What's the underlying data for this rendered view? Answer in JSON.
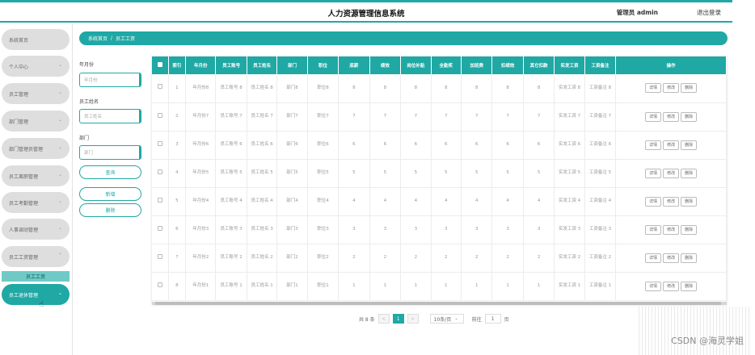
{
  "header": {
    "title": "人力资源管理信息系统",
    "admin": "管理员 admin",
    "logout": "退出登录"
  },
  "sidebar": {
    "items": [
      "系统首页",
      "个人中心",
      "员工管理",
      "部门管理",
      "部门管理员管理",
      "员工离职管理",
      "员工考勤管理",
      "人事调动管理",
      "员工工资管理",
      "员工退休管理"
    ],
    "sub_item": "员工工资"
  },
  "breadcrumb": {
    "home": "系统首页",
    "sep": "/",
    "current": "员工工资"
  },
  "filters": {
    "month_label": "年月份",
    "month_placeholder": "年月份",
    "name_label": "员工姓名",
    "name_placeholder": "员工姓名",
    "dept_label": "部门",
    "dept_placeholder": "部门",
    "search_btn": "查询",
    "add_btn": "新增",
    "delete_btn": "删除"
  },
  "table": {
    "headers": [
      "索引",
      "年月份",
      "员工账号",
      "员工姓名",
      "部门",
      "职位",
      "底薪",
      "绩效",
      "岗位补贴",
      "全勤奖",
      "加班费",
      "扣绩效",
      "其它扣款",
      "实发工资",
      "工资备注",
      "操作"
    ],
    "actions": {
      "detail": "详情",
      "edit": "修改",
      "delete": "删除"
    },
    "rows": [
      {
        "idx": "1",
        "month": "年月份8",
        "acct": "员工账号 8",
        "name": "员工姓名 8",
        "dept": "部门8",
        "pos": "职位8",
        "base": "8",
        "perf": "8",
        "allow": "8",
        "attend": "8",
        "ot": "8",
        "dperf": "8",
        "other": "8",
        "actual": "实发工资 8",
        "note": "工资备注 8"
      },
      {
        "idx": "2",
        "month": "年月份7",
        "acct": "员工账号 7",
        "name": "员工姓名 7",
        "dept": "部门7",
        "pos": "职位7",
        "base": "7",
        "perf": "7",
        "allow": "7",
        "attend": "7",
        "ot": "7",
        "dperf": "7",
        "other": "7",
        "actual": "实发工资 7",
        "note": "工资备注 7"
      },
      {
        "idx": "3",
        "month": "年月份6",
        "acct": "员工账号 6",
        "name": "员工姓名 6",
        "dept": "部门6",
        "pos": "职位6",
        "base": "6",
        "perf": "6",
        "allow": "6",
        "attend": "6",
        "ot": "6",
        "dperf": "6",
        "other": "6",
        "actual": "实发工资 6",
        "note": "工资备注 6"
      },
      {
        "idx": "4",
        "month": "年月份5",
        "acct": "员工账号 5",
        "name": "员工姓名 5",
        "dept": "部门5",
        "pos": "职位5",
        "base": "5",
        "perf": "5",
        "allow": "5",
        "attend": "5",
        "ot": "5",
        "dperf": "5",
        "other": "5",
        "actual": "实发工资 5",
        "note": "工资备注 5"
      },
      {
        "idx": "5",
        "month": "年月份4",
        "acct": "员工账号 4",
        "name": "员工姓名 4",
        "dept": "部门4",
        "pos": "职位4",
        "base": "4",
        "perf": "4",
        "allow": "4",
        "attend": "4",
        "ot": "4",
        "dperf": "4",
        "other": "4",
        "actual": "实发工资 4",
        "note": "工资备注 4"
      },
      {
        "idx": "6",
        "month": "年月份3",
        "acct": "员工账号 3",
        "name": "员工姓名 3",
        "dept": "部门3",
        "pos": "职位3",
        "base": "3",
        "perf": "3",
        "allow": "3",
        "attend": "3",
        "ot": "3",
        "dperf": "3",
        "other": "3",
        "actual": "实发工资 3",
        "note": "工资备注 3"
      },
      {
        "idx": "7",
        "month": "年月份2",
        "acct": "员工账号 2",
        "name": "员工姓名 2",
        "dept": "部门2",
        "pos": "职位2",
        "base": "2",
        "perf": "2",
        "allow": "2",
        "attend": "2",
        "ot": "2",
        "dperf": "2",
        "other": "2",
        "actual": "实发工资 2",
        "note": "工资备注 2"
      },
      {
        "idx": "8",
        "month": "年月份1",
        "acct": "员工账号 1",
        "name": "员工姓名 1",
        "dept": "部门1",
        "pos": "职位1",
        "base": "1",
        "perf": "1",
        "allow": "1",
        "attend": "1",
        "ot": "1",
        "dperf": "1",
        "other": "1",
        "actual": "实发工资 1",
        "note": "工资备注 1"
      }
    ]
  },
  "pagination": {
    "total": "共 8 条",
    "prev": "<",
    "current": "1",
    "next": ">",
    "page_size": "10条/页",
    "goto_label": "前往",
    "goto_value": "1",
    "page_unit": "页"
  },
  "watermark": "CSDN @海灵学姐",
  "colors": {
    "accent": "#20a8a4"
  }
}
